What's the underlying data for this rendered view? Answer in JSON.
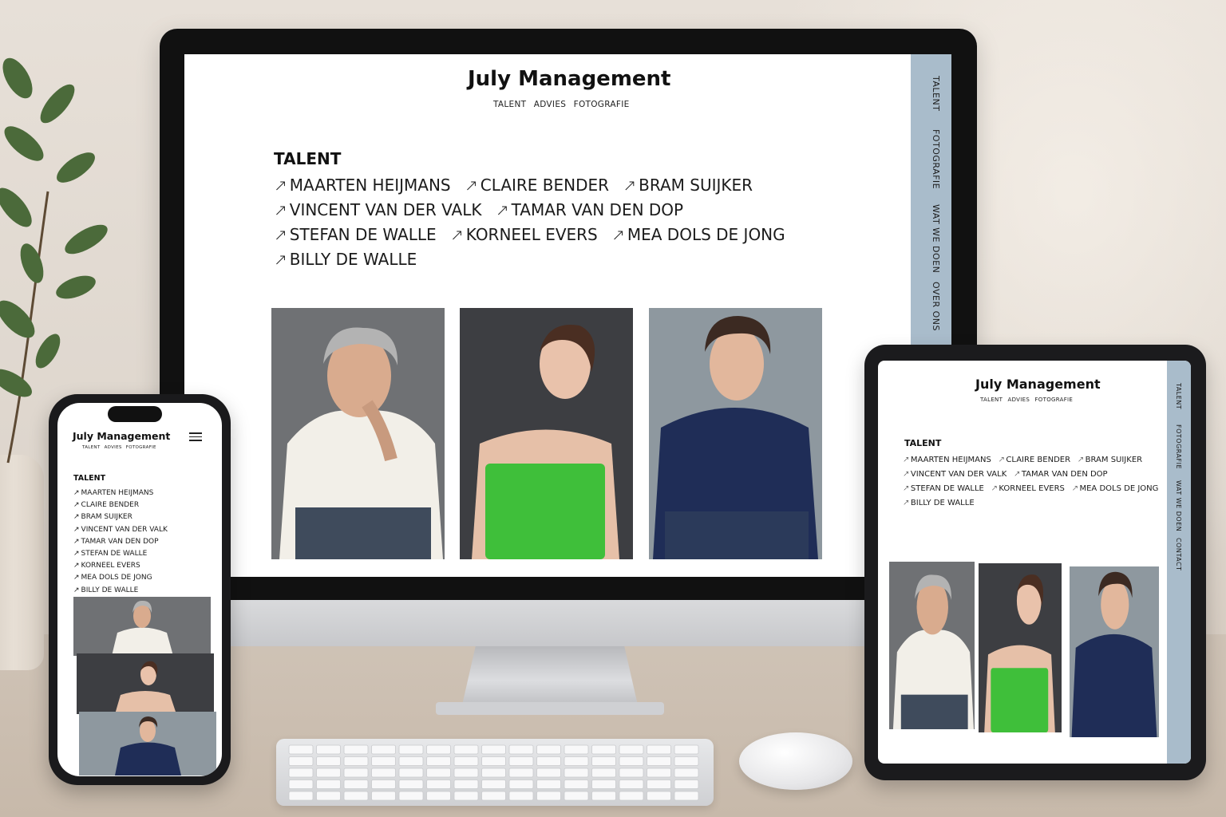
{
  "site": {
    "title": "July Management",
    "subnav": [
      "TALENT",
      "ADVIES",
      "FOTOGRAFIE"
    ]
  },
  "sidebar": {
    "items": [
      "TALENT",
      "FOTOGRAFIE",
      "WAT WE DOEN",
      "OVER ONS",
      "CONTACT"
    ]
  },
  "talent": {
    "heading": "TALENT",
    "arrow_glyph": "↗",
    "names": [
      "MAARTEN HEIJMANS",
      "CLAIRE BENDER",
      "BRAM SUIJKER",
      "VINCENT VAN DER VALK",
      "TAMAR VAN DEN DOP",
      "STEFAN DE WALLE",
      "KORNEEL EVERS",
      "MEA DOLS DE JONG",
      "BILLY DE WALLE"
    ]
  },
  "colors": {
    "sidebar": "#a9bccb",
    "photo_bg_1": "#6f7174",
    "photo_bg_2": "#3d3e42",
    "photo_bg_3": "#8e989f",
    "green_top": "#3fbf3a",
    "navy_sweater": "#1f2d57"
  }
}
